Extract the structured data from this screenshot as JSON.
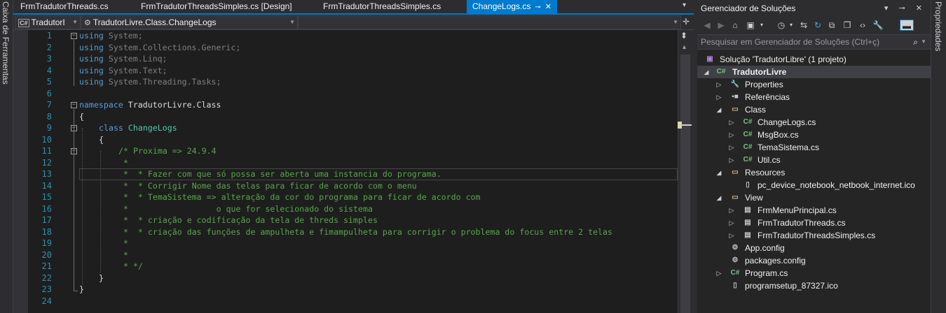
{
  "left_strip": {
    "label": "Caixa de Ferramentas"
  },
  "right_strip": {
    "label": "Propriedades"
  },
  "tabs": [
    {
      "label": "FrmTradutorThreads.cs"
    },
    {
      "label": "FrmTradutorThreadsSimples.cs [Design]"
    },
    {
      "label": "FrmTradutorThreadsSimples.cs"
    },
    {
      "label": "ChangeLogs.cs",
      "pin": "⊸",
      "close": "✕"
    }
  ],
  "navbar": {
    "project_badge": "C#",
    "project": "TradutorI",
    "class_path": "TradutorLivre.Class.ChangeLogs",
    "member": ""
  },
  "editor": {
    "lines": [
      {
        "n": "1"
      },
      {
        "n": "2"
      },
      {
        "n": "3"
      },
      {
        "n": "4"
      },
      {
        "n": "5"
      },
      {
        "n": "6"
      },
      {
        "n": "7"
      },
      {
        "n": "8"
      },
      {
        "n": "9"
      },
      {
        "n": "10"
      },
      {
        "n": "11"
      },
      {
        "n": "12"
      },
      {
        "n": "13"
      },
      {
        "n": "14"
      },
      {
        "n": "15"
      },
      {
        "n": "16"
      },
      {
        "n": "17"
      },
      {
        "n": "18"
      },
      {
        "n": "19"
      },
      {
        "n": "20"
      },
      {
        "n": "21"
      },
      {
        "n": "22"
      },
      {
        "n": "23"
      },
      {
        "n": "24"
      }
    ],
    "code": {
      "l1_kw": "using",
      "l1_rest": " System;",
      "l2_kw": "using",
      "l2_rest": " System.Collections.Generic;",
      "l3_kw": "using",
      "l3_rest": " System.Linq;",
      "l4_kw": "using",
      "l4_rest": " System.Text;",
      "l5_kw": "using",
      "l5_rest": " System.Threading.Tasks;",
      "l7_kw": "namespace",
      "l7_rest": " TradutorLivre.Class",
      "l8": "{",
      "l9_kw": "class",
      "l9_cls": "ChangeLogs",
      "l10": "{",
      "l11": "/* Proxima => 24.9.4",
      "l12": " *",
      "l13": " *  * Fazer com que só possa ser aberta uma instancia do programa.",
      "l14": " *  * Corrigir Nome das telas para ficar de acordo com o menu",
      "l15": " *  * TemaSistema => alteração da cor do programa para ficar de acordo com",
      "l16": " *                  o que for selecionado do sistema",
      "l17": " *  * criação e codificação da tela de threds simples",
      "l18": " *  * criação das funções de ampulheta e fimampulheta para corrigir o problema do focus entre 2 telas",
      "l19": " *",
      "l20": " *",
      "l21": " * */",
      "l22": "}",
      "l23": "}"
    }
  },
  "solution_explorer": {
    "title": "Gerenciador de Soluções",
    "title_icons": "▾ ⊸ ✕",
    "search_placeholder": "Pesquisar em Gerenciador de Soluções (Ctrl+ç)",
    "tree": [
      {
        "label": "Solução 'TradutorLibre' (1 projeto)",
        "icon": "solution-icon"
      },
      {
        "label": "TradutorLivre",
        "icon": "csharp-project-icon"
      },
      {
        "label": "Properties",
        "icon": "wrench-icon"
      },
      {
        "label": "Referências",
        "icon": "references-icon"
      },
      {
        "label": "Class",
        "icon": "folder-icon"
      },
      {
        "label": "ChangeLogs.cs",
        "icon": "csharp-file-icon"
      },
      {
        "label": "MsgBox.cs",
        "icon": "csharp-file-icon"
      },
      {
        "label": "TemaSistema.cs",
        "icon": "csharp-file-icon"
      },
      {
        "label": "Util.cs",
        "icon": "csharp-file-icon"
      },
      {
        "label": "Resources",
        "icon": "folder-icon"
      },
      {
        "label": "pc_device_notebook_netbook_internet.ico",
        "icon": "file-icon"
      },
      {
        "label": "View",
        "icon": "folder-icon"
      },
      {
        "label": "FrmMenuPrincipal.cs",
        "icon": "form-icon"
      },
      {
        "label": "FrmTradutorThreads.cs",
        "icon": "form-icon"
      },
      {
        "label": "FrmTradutorThreadsSimples.cs",
        "icon": "form-icon"
      },
      {
        "label": "App.config",
        "icon": "config-icon"
      },
      {
        "label": "packages.config",
        "icon": "config-icon"
      },
      {
        "label": "Program.cs",
        "icon": "csharp-file-icon"
      },
      {
        "label": "programsetup_87327.ico",
        "icon": "file-icon"
      }
    ]
  },
  "colors": {
    "accent": "#007acc",
    "keyword": "#569cd6",
    "comment": "#57a64a",
    "type": "#4ec9b0",
    "line_number": "#2b91af"
  }
}
